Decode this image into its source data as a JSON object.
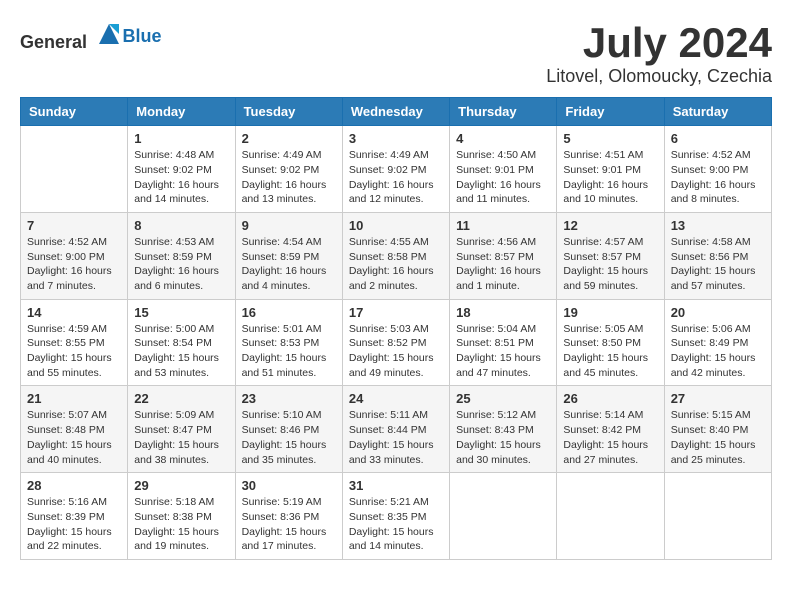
{
  "header": {
    "logo_general": "General",
    "logo_blue": "Blue",
    "month_year": "July 2024",
    "location": "Litovel, Olomoucky, Czechia"
  },
  "weekdays": [
    "Sunday",
    "Monday",
    "Tuesday",
    "Wednesday",
    "Thursday",
    "Friday",
    "Saturday"
  ],
  "weeks": [
    [
      {
        "day": "",
        "info": ""
      },
      {
        "day": "1",
        "info": "Sunrise: 4:48 AM\nSunset: 9:02 PM\nDaylight: 16 hours\nand 14 minutes."
      },
      {
        "day": "2",
        "info": "Sunrise: 4:49 AM\nSunset: 9:02 PM\nDaylight: 16 hours\nand 13 minutes."
      },
      {
        "day": "3",
        "info": "Sunrise: 4:49 AM\nSunset: 9:02 PM\nDaylight: 16 hours\nand 12 minutes."
      },
      {
        "day": "4",
        "info": "Sunrise: 4:50 AM\nSunset: 9:01 PM\nDaylight: 16 hours\nand 11 minutes."
      },
      {
        "day": "5",
        "info": "Sunrise: 4:51 AM\nSunset: 9:01 PM\nDaylight: 16 hours\nand 10 minutes."
      },
      {
        "day": "6",
        "info": "Sunrise: 4:52 AM\nSunset: 9:00 PM\nDaylight: 16 hours\nand 8 minutes."
      }
    ],
    [
      {
        "day": "7",
        "info": "Sunrise: 4:52 AM\nSunset: 9:00 PM\nDaylight: 16 hours\nand 7 minutes."
      },
      {
        "day": "8",
        "info": "Sunrise: 4:53 AM\nSunset: 8:59 PM\nDaylight: 16 hours\nand 6 minutes."
      },
      {
        "day": "9",
        "info": "Sunrise: 4:54 AM\nSunset: 8:59 PM\nDaylight: 16 hours\nand 4 minutes."
      },
      {
        "day": "10",
        "info": "Sunrise: 4:55 AM\nSunset: 8:58 PM\nDaylight: 16 hours\nand 2 minutes."
      },
      {
        "day": "11",
        "info": "Sunrise: 4:56 AM\nSunset: 8:57 PM\nDaylight: 16 hours\nand 1 minute."
      },
      {
        "day": "12",
        "info": "Sunrise: 4:57 AM\nSunset: 8:57 PM\nDaylight: 15 hours\nand 59 minutes."
      },
      {
        "day": "13",
        "info": "Sunrise: 4:58 AM\nSunset: 8:56 PM\nDaylight: 15 hours\nand 57 minutes."
      }
    ],
    [
      {
        "day": "14",
        "info": "Sunrise: 4:59 AM\nSunset: 8:55 PM\nDaylight: 15 hours\nand 55 minutes."
      },
      {
        "day": "15",
        "info": "Sunrise: 5:00 AM\nSunset: 8:54 PM\nDaylight: 15 hours\nand 53 minutes."
      },
      {
        "day": "16",
        "info": "Sunrise: 5:01 AM\nSunset: 8:53 PM\nDaylight: 15 hours\nand 51 minutes."
      },
      {
        "day": "17",
        "info": "Sunrise: 5:03 AM\nSunset: 8:52 PM\nDaylight: 15 hours\nand 49 minutes."
      },
      {
        "day": "18",
        "info": "Sunrise: 5:04 AM\nSunset: 8:51 PM\nDaylight: 15 hours\nand 47 minutes."
      },
      {
        "day": "19",
        "info": "Sunrise: 5:05 AM\nSunset: 8:50 PM\nDaylight: 15 hours\nand 45 minutes."
      },
      {
        "day": "20",
        "info": "Sunrise: 5:06 AM\nSunset: 8:49 PM\nDaylight: 15 hours\nand 42 minutes."
      }
    ],
    [
      {
        "day": "21",
        "info": "Sunrise: 5:07 AM\nSunset: 8:48 PM\nDaylight: 15 hours\nand 40 minutes."
      },
      {
        "day": "22",
        "info": "Sunrise: 5:09 AM\nSunset: 8:47 PM\nDaylight: 15 hours\nand 38 minutes."
      },
      {
        "day": "23",
        "info": "Sunrise: 5:10 AM\nSunset: 8:46 PM\nDaylight: 15 hours\nand 35 minutes."
      },
      {
        "day": "24",
        "info": "Sunrise: 5:11 AM\nSunset: 8:44 PM\nDaylight: 15 hours\nand 33 minutes."
      },
      {
        "day": "25",
        "info": "Sunrise: 5:12 AM\nSunset: 8:43 PM\nDaylight: 15 hours\nand 30 minutes."
      },
      {
        "day": "26",
        "info": "Sunrise: 5:14 AM\nSunset: 8:42 PM\nDaylight: 15 hours\nand 27 minutes."
      },
      {
        "day": "27",
        "info": "Sunrise: 5:15 AM\nSunset: 8:40 PM\nDaylight: 15 hours\nand 25 minutes."
      }
    ],
    [
      {
        "day": "28",
        "info": "Sunrise: 5:16 AM\nSunset: 8:39 PM\nDaylight: 15 hours\nand 22 minutes."
      },
      {
        "day": "29",
        "info": "Sunrise: 5:18 AM\nSunset: 8:38 PM\nDaylight: 15 hours\nand 19 minutes."
      },
      {
        "day": "30",
        "info": "Sunrise: 5:19 AM\nSunset: 8:36 PM\nDaylight: 15 hours\nand 17 minutes."
      },
      {
        "day": "31",
        "info": "Sunrise: 5:21 AM\nSunset: 8:35 PM\nDaylight: 15 hours\nand 14 minutes."
      },
      {
        "day": "",
        "info": ""
      },
      {
        "day": "",
        "info": ""
      },
      {
        "day": "",
        "info": ""
      }
    ]
  ]
}
